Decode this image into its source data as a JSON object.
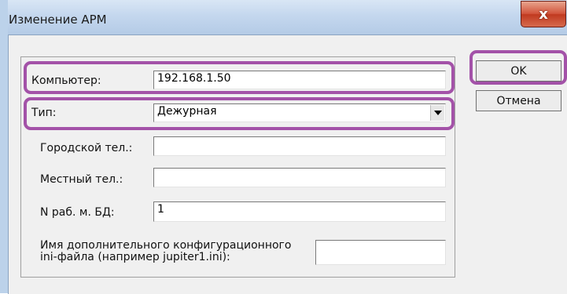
{
  "window": {
    "title": "Изменение АРМ",
    "close_glyph": "x"
  },
  "form": {
    "computer": {
      "label": "Компьютер:",
      "value": "192.168.1.50"
    },
    "type": {
      "label": "Тип:",
      "value": "Дежурная"
    },
    "city_phone": {
      "label": "Городской тел.:",
      "value": ""
    },
    "local_phone": {
      "label": "Местный тел.:",
      "value": ""
    },
    "workstation_db": {
      "label": "N раб. м. БД:",
      "value": "1"
    },
    "ini_file": {
      "label_line1": "Имя дополнительного конфигурационного",
      "label_line2": "ini-файла (например jupiter1.ini):",
      "value": ""
    }
  },
  "buttons": {
    "ok": "OK",
    "cancel": "Отмена"
  },
  "colors": {
    "highlight": "#a352a8",
    "titlebar": "#c4d7ee",
    "close_button": "#d2553c"
  }
}
